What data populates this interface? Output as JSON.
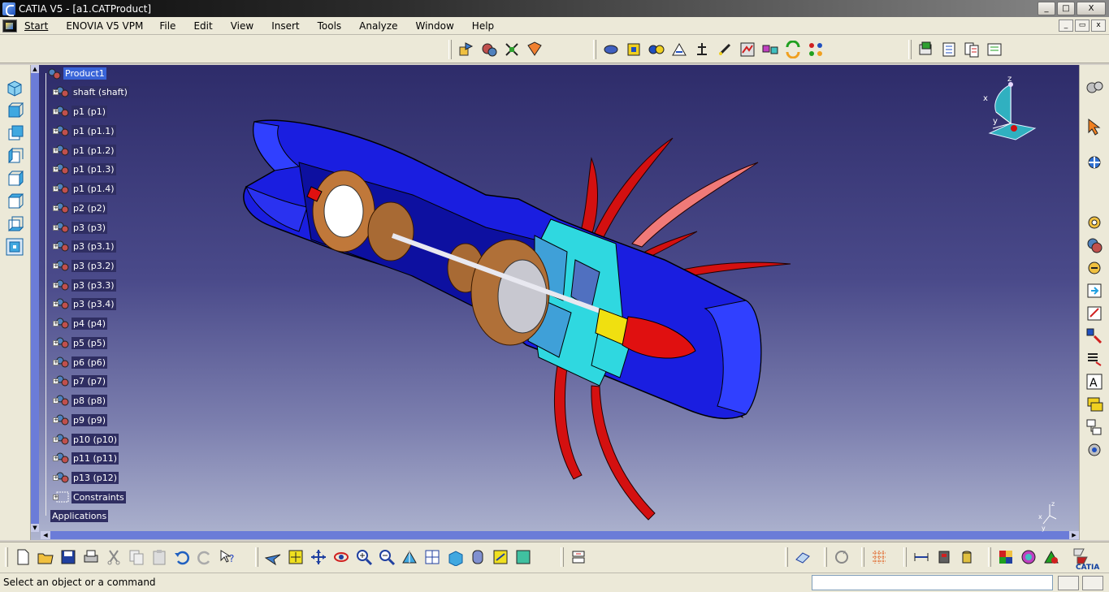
{
  "window": {
    "title": "CATIA V5 - [a1.CATProduct]",
    "controls": {
      "minimize": "_",
      "maximize": "□",
      "close": "X"
    }
  },
  "menu": {
    "items": [
      "Start",
      "ENOVIA V5 VPM",
      "File",
      "Edit",
      "View",
      "Insert",
      "Tools",
      "Analyze",
      "Window",
      "Help"
    ]
  },
  "mdi_controls": {
    "minimize": "_",
    "restore": "▭",
    "close": "x"
  },
  "spec_tree": {
    "root": "Product1",
    "nodes": [
      "shaft (shaft)",
      "p1 (p1)",
      "p1 (p1.1)",
      "p1 (p1.2)",
      "p1 (p1.3)",
      "p1 (p1.4)",
      "p2 (p2)",
      "p3 (p3)",
      "p3 (p3.1)",
      "p3 (p3.2)",
      "p3 (p3.3)",
      "p3 (p3.4)",
      "p4 (p4)",
      "p5 (p5)",
      "p6 (p6)",
      "p7 (p7)",
      "p8 (p8)",
      "p9 (p9)",
      "p10 (p10)",
      "p11 (p11)",
      "p13 (p12)",
      "Constraints"
    ],
    "applications": "Applications"
  },
  "compass": {
    "x_label": "x",
    "y_label": "y",
    "z_label": "z"
  },
  "axis_triad": {
    "x_label": "x",
    "y_label": "y",
    "z_label": "z"
  },
  "status": {
    "message": "Select an object or a command",
    "command_value": ""
  },
  "brand": {
    "logo_text": "CATIA"
  },
  "colors": {
    "viewport_top": "#2e2c6a",
    "viewport_bottom": "#aeb4cf",
    "model_blue": "#1a1ee0",
    "model_cyan": "#2fd8e0",
    "blade_red": "#d41010",
    "blade_salmon": "#f07a78",
    "cone_red": "#e01010",
    "cone_yellow": "#f0e010"
  }
}
